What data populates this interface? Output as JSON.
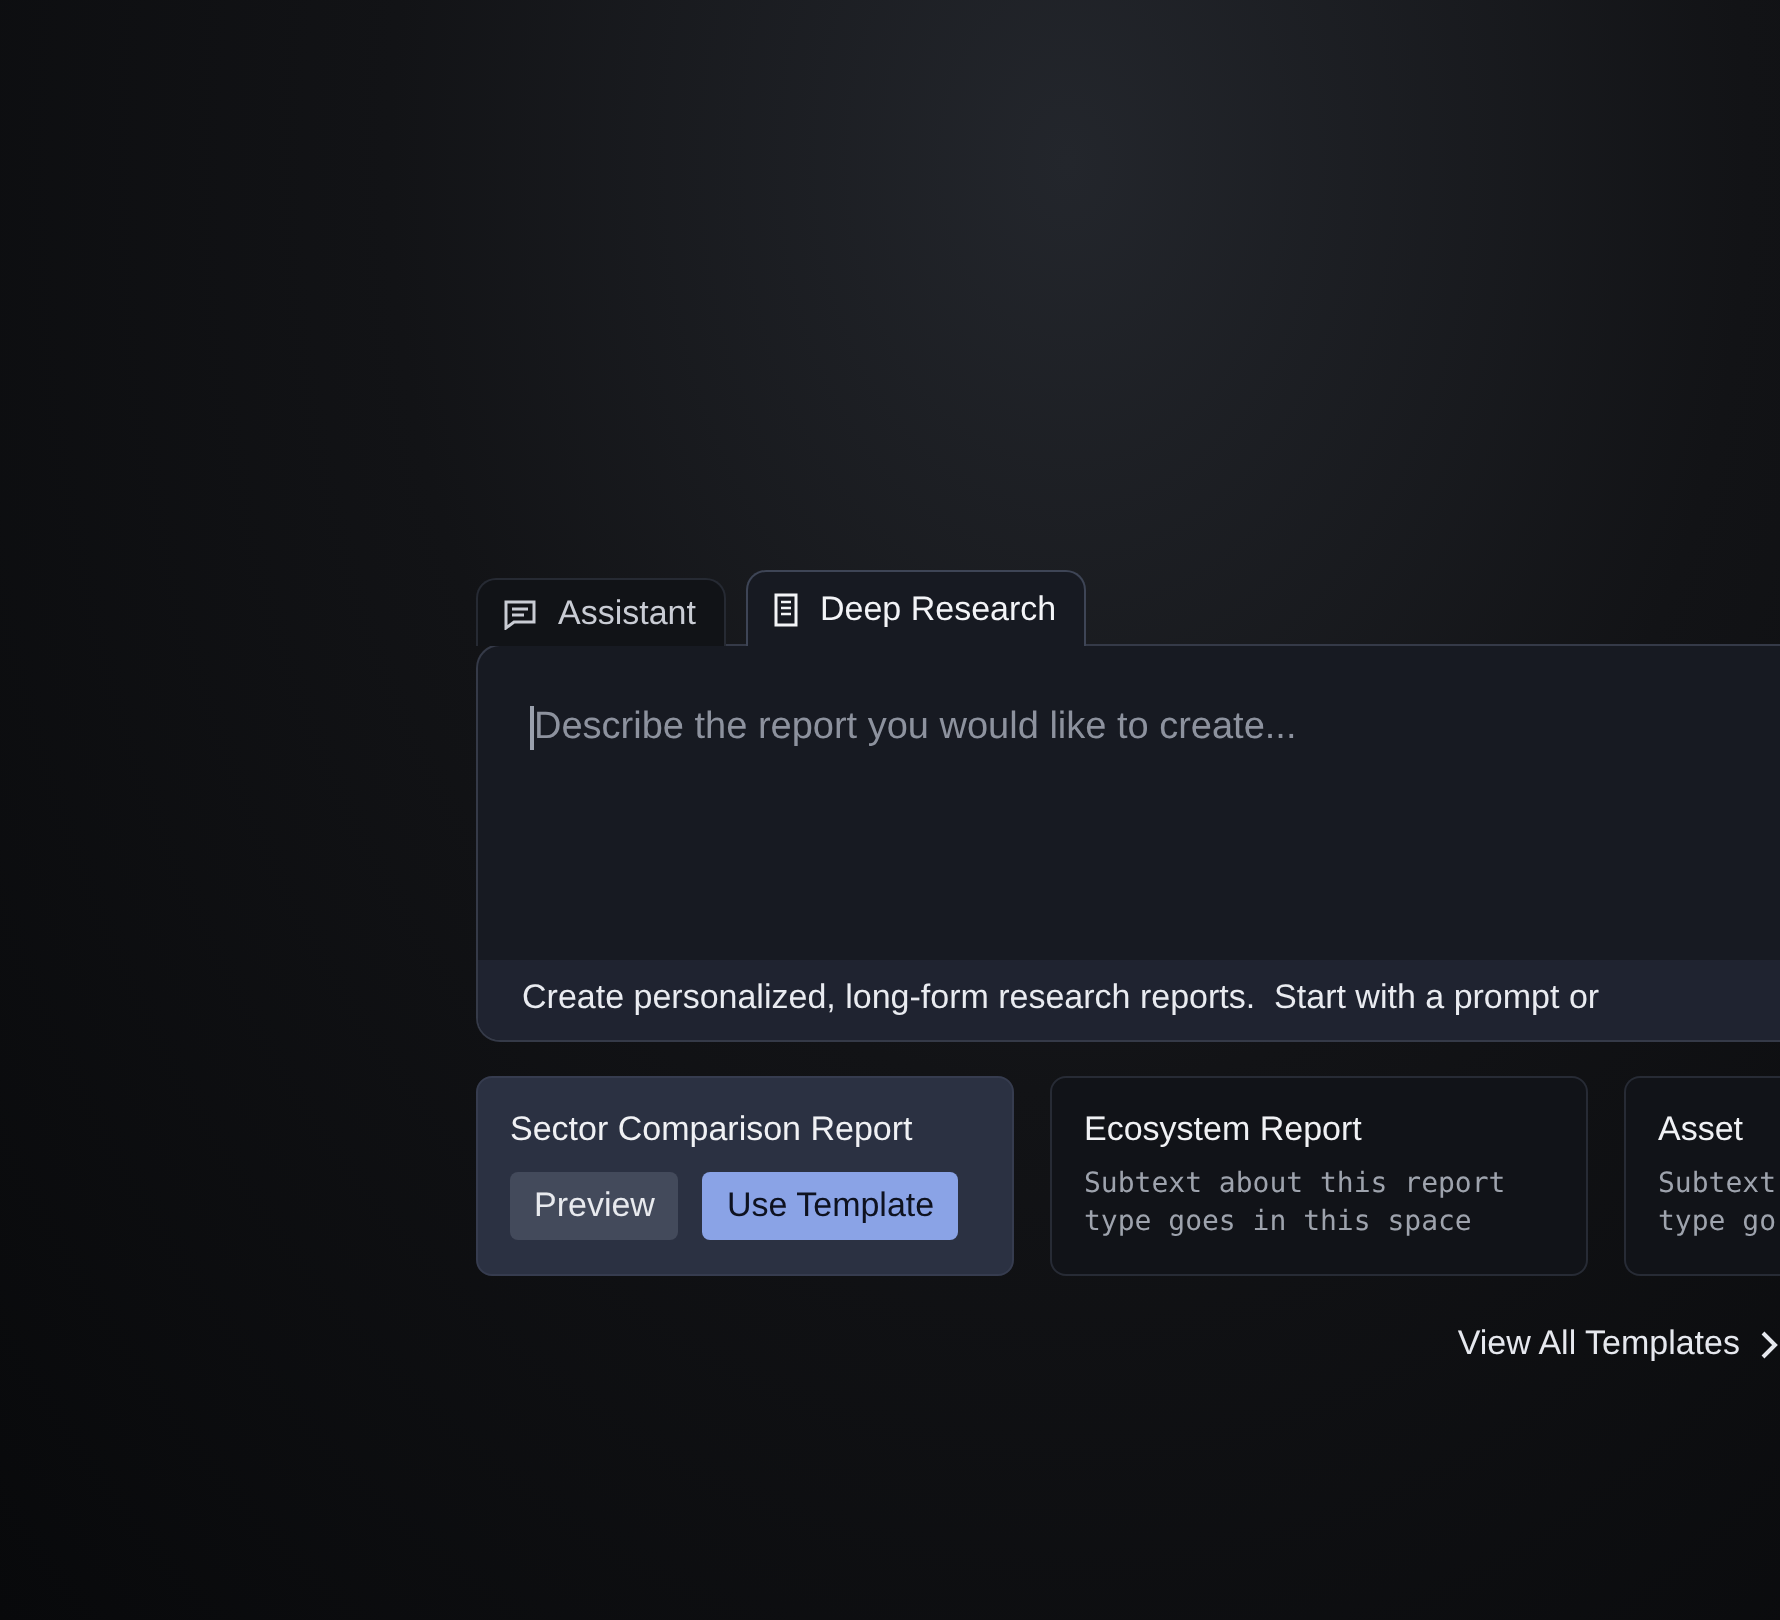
{
  "tabs": [
    {
      "label": "Assistant",
      "kind": "chat",
      "selected": false
    },
    {
      "label": "Deep Research",
      "kind": "document",
      "selected": true
    }
  ],
  "prompt": {
    "placeholder": "Describe the report you would like to create...",
    "hint": "Create personalized, long-form research reports.  Start with a prompt or"
  },
  "templates": [
    {
      "title": "Sector Comparison Report",
      "selected": true,
      "buttons": [
        {
          "label": "Preview",
          "kind": "secondary"
        },
        {
          "label": "Use Template",
          "kind": "primary"
        }
      ]
    },
    {
      "title": "Ecosystem Report",
      "selected": false,
      "subtext": [
        "Subtext about this report",
        "type goes in this space"
      ]
    },
    {
      "title": "Asset",
      "selected": false,
      "subtext": [
        "Subtext",
        "type go"
      ]
    }
  ],
  "view_all": {
    "label": "View All Templates"
  }
}
